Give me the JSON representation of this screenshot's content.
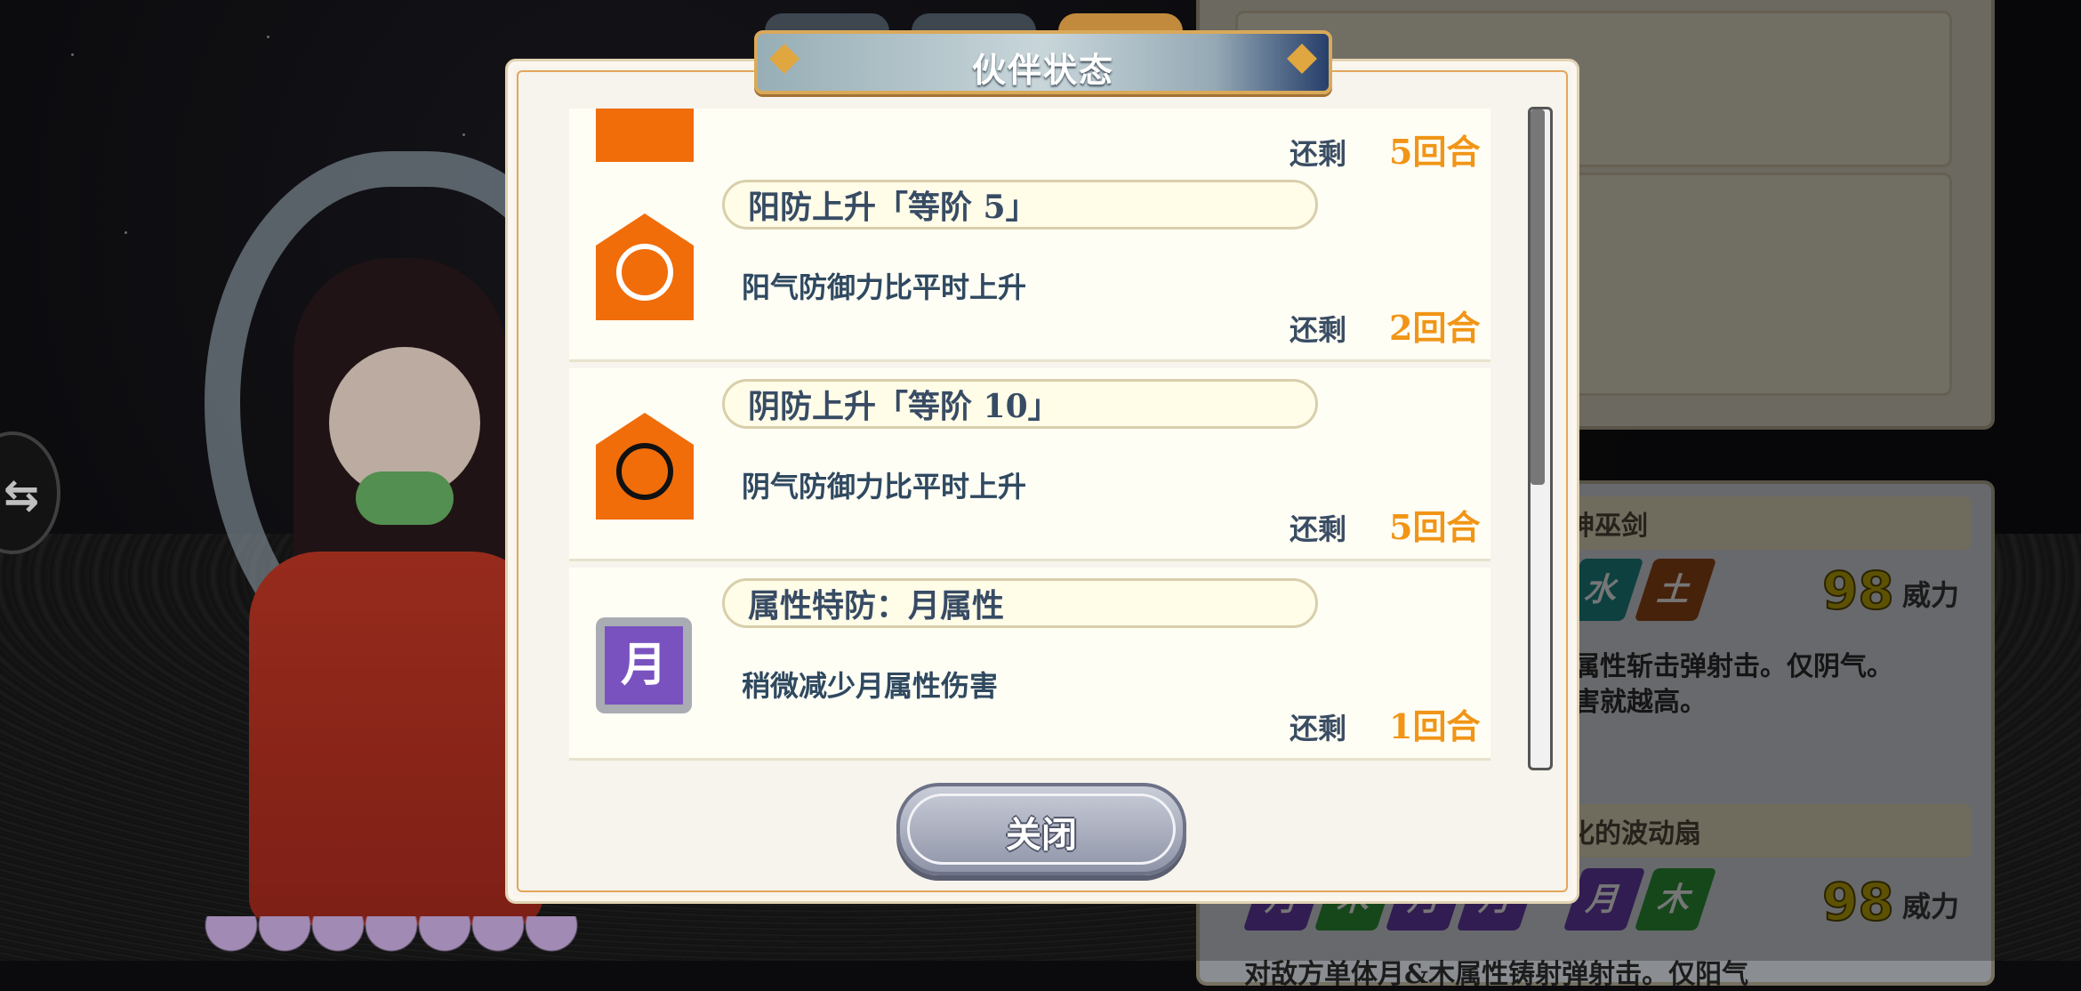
{
  "dialog": {
    "title": "伙伴状态",
    "close_label": "关闭"
  },
  "status_rows": [
    {
      "name": "",
      "description": "",
      "remaining_label": "还剩",
      "remaining_value": "5回合",
      "icon": "orange-shield-swirl-icon"
    },
    {
      "name": "阳防上升「等阶 5」",
      "description": "阳气防御力比平时上升",
      "remaining_label": "还剩",
      "remaining_value": "2回合",
      "icon": "yang-defense-up-icon"
    },
    {
      "name": "阴防上升「等阶 10」",
      "description": "阴气防御力比平时上升",
      "remaining_label": "还剩",
      "remaining_value": "5回合",
      "icon": "yin-defense-up-icon"
    },
    {
      "name": "属性特防：月属性",
      "description": "稍微减少月属性伤害",
      "remaining_label": "还剩",
      "remaining_value": "1回合",
      "icon": "moon-element-icon",
      "icon_text": "月"
    }
  ],
  "background_panel": {
    "status_icon_text": "月",
    "skills": [
      {
        "name_fragment": "神巫剑",
        "elements": [
          "水",
          "土"
        ],
        "power": "98",
        "power_label": "威力",
        "desc_line1": "属性斩击弹射击。仅阴气。",
        "desc_line2": "害就越高。"
      },
      {
        "name_fragment": "化的波动扇",
        "elements": [
          "月",
          "木",
          "月",
          "月",
          "月",
          "木"
        ],
        "power": "98",
        "power_label": "威力",
        "desc_line1": "对敌方单体月&木属性铸射弹射击。仅阳气"
      }
    ]
  },
  "colors": {
    "accent_orange": "#f19516",
    "title_blue": "#374b64",
    "moon_purple": "#7a52c0"
  }
}
